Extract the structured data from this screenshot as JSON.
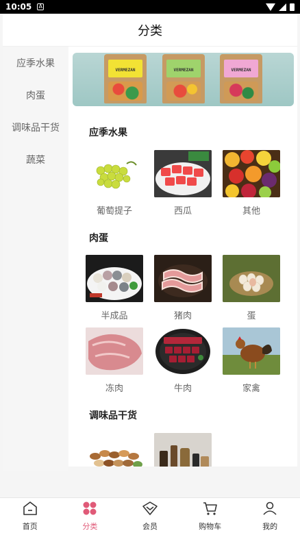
{
  "status_bar": {
    "time": "10:05",
    "notif": "A"
  },
  "header": {
    "title": "分类"
  },
  "sidebar": {
    "items": [
      {
        "label": "应季水果"
      },
      {
        "label": "肉蛋"
      },
      {
        "label": "调味品干货"
      },
      {
        "label": "蔬菜"
      }
    ]
  },
  "banner": {
    "brand": "VERMEZAN"
  },
  "sections": [
    {
      "title": "应季水果",
      "items": [
        {
          "name": "葡萄提子"
        },
        {
          "name": "西瓜"
        },
        {
          "name": "其他"
        }
      ]
    },
    {
      "title": "肉蛋",
      "items": [
        {
          "name": "半成品"
        },
        {
          "name": "猪肉"
        },
        {
          "name": "蛋"
        },
        {
          "name": "冻肉"
        },
        {
          "name": "牛肉"
        },
        {
          "name": "家禽"
        }
      ]
    },
    {
      "title": "调味品干货",
      "items": [
        {
          "name": ""
        },
        {
          "name": ""
        }
      ]
    }
  ],
  "bottom_nav": {
    "items": [
      {
        "label": "首页",
        "icon": "home-icon"
      },
      {
        "label": "分类",
        "icon": "category-icon",
        "active": true
      },
      {
        "label": "会员",
        "icon": "member-icon"
      },
      {
        "label": "购物车",
        "icon": "cart-icon"
      },
      {
        "label": "我的",
        "icon": "profile-icon"
      }
    ]
  },
  "colors": {
    "accent": "#e05a78"
  }
}
